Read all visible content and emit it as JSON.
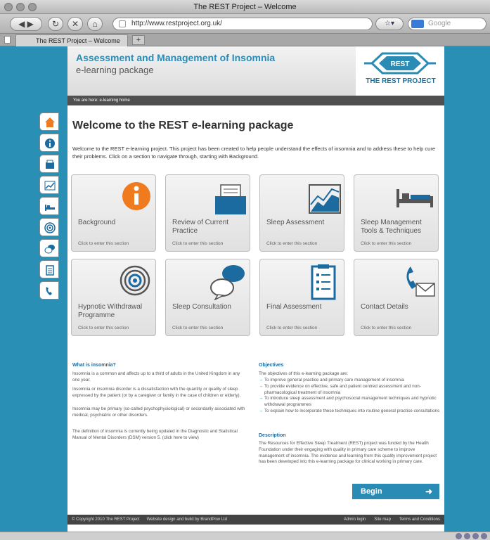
{
  "browser": {
    "window_title": "The REST Project – Welcome",
    "url": "http://www.restproject.org.uk/",
    "search_placeholder": "Google",
    "tab_title": "The REST Project – Welcome",
    "new_tab": "+"
  },
  "header": {
    "title": "Assessment and Management of Insomnia",
    "subtitle": "e-learning package",
    "logo_badge": "REST",
    "logo_text": "THE REST PROJECT"
  },
  "breadcrumb": "You are here: e-learning home",
  "page": {
    "heading": "Welcome to the REST e-learning package",
    "intro": "Welcome to the REST e-learning project. This project has been created to help people understand the effects of insomnia and to address these to help cure their problems. Click on a section to navigate through, starting with Background."
  },
  "cards": [
    {
      "title": "Background",
      "cta": "Click to enter this section"
    },
    {
      "title": "Review of Current Practice",
      "cta": "Click to enter this section"
    },
    {
      "title": "Sleep Assessment",
      "cta": "Click to enter this section"
    },
    {
      "title": "Sleep Management Tools & Techniques",
      "cta": "Click to enter this section"
    },
    {
      "title": "Hypnotic Withdrawal Programme",
      "cta": "Click to enter this section"
    },
    {
      "title": "Sleep Consultation",
      "cta": "Click to enter this section"
    },
    {
      "title": "Final Assessment",
      "cta": "Click to enter this section"
    },
    {
      "title": "Contact Details",
      "cta": "Click to enter this section"
    }
  ],
  "what_is_insomnia": {
    "heading": "What is insomnia?",
    "p1": "Insomnia is a common and affects up to a third of adults in the United Kingdom in any one year.",
    "p2": "Insomnia or insomnia disorder is a dissatisfaction with the quantity or quality of sleep expressed by the patient (or by a caregiver or family in the case of children or elderly).",
    "p3": "Insomnia may be primary (so-called psychophysiological) or secondarily associated with medical, psychiatric or other disorders.",
    "p4": "The definition of insomnia is currently being updated in the Diagnostic and Statistical Manual of Mental Disorders (DSM) version 5. (click here to view)"
  },
  "objectives": {
    "heading": "Objectives",
    "intro": "The objectives of this e-learning package are:",
    "items": [
      "To improve general practice and primary care management of insomnia",
      "To provide evidence on effective, safe and patient centred assessment and non-pharmacological treatment of insomnia",
      "To introduce sleep assessment and psychosocial management techniques and hypnotic withdrawal programmes",
      "To explain how to incorporate these techniques into routine general practice consultations"
    ]
  },
  "description": {
    "heading": "Description",
    "text": "The Resources for Effective Sleep Treatment (REST) project was funded by the Health Foundation under their engaging with quality in primary care scheme to improve management of insomnia. The evidence and learning from this quality improvement project has been developed into this e-learning package for clinical working in primary care."
  },
  "begin_label": "Begin",
  "footer": {
    "copyright": "© Copyright 2010 The REST Project",
    "credit": "Website design and build by BrandPow Ltd",
    "links": [
      "Admin login",
      "Site map",
      "Terms and Conditions"
    ]
  },
  "colors": {
    "accent": "#2a8bb5",
    "background": "#2a8fb5",
    "orange": "#f07a1e"
  }
}
